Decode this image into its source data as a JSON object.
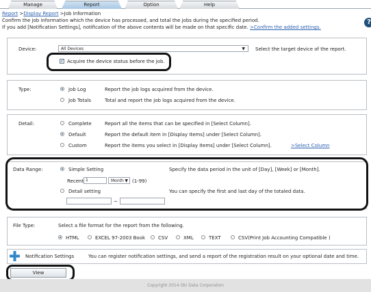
{
  "tabs": [
    {
      "label": "Manage",
      "active": false
    },
    {
      "label": "Report",
      "active": true
    },
    {
      "label": "Option",
      "active": false
    },
    {
      "label": "Help",
      "active": false
    }
  ],
  "breadcrumb": {
    "item1": "Report",
    "item2": "Display Report",
    "current": "Job Information",
    "sep": ">"
  },
  "intro": {
    "line1": "Confirm the job information which the device has processed, and total the jobs during the specified period.",
    "line2": "If you add [Notification Settings], notification of the above contents will be made on that specific date.",
    "link": ">Confirm the added settings."
  },
  "device": {
    "label": "Device:",
    "selected": "All Devices",
    "hint": "Select the target device of the report.",
    "checkbox_label": "Acquire the device status before the job.",
    "checkbox_checked": true
  },
  "type": {
    "label": "Type:",
    "options": [
      {
        "label": "Job Log",
        "desc": "Report the job logs acquired from the device.",
        "checked": true
      },
      {
        "label": "Job Totals",
        "desc": "Total and report the job logs acquired from the device.",
        "checked": false
      }
    ]
  },
  "detail": {
    "label": "Detail:",
    "options": [
      {
        "label": "Complete",
        "desc": "Report all the items that can be specified in [Select Column].",
        "checked": false
      },
      {
        "label": "Default",
        "desc": "Report the default item in [Display Items] under [Select Column].",
        "checked": true
      },
      {
        "label": "Custom",
        "desc": "Report the items you select in [Display Items] under [Select Column].",
        "checked": false
      }
    ],
    "select_column_link": ">Select Column"
  },
  "data_range": {
    "label": "Data Range:",
    "simple_label": "Simple Setting",
    "simple_desc": "Specify the data period in the unit of [Day], [Week] or [Month].",
    "recent_label": "Recent",
    "recent_value": "1",
    "unit_selected": "Month",
    "range_hint": "(1-99)",
    "detail_label": "Detail setting",
    "detail_desc": "You can specify the first and last day of the totaled data.",
    "tilde": "~"
  },
  "file_type": {
    "label": "File Type:",
    "prompt": "Select a file format for the report from the following.",
    "options": [
      {
        "label": "HTML",
        "checked": true
      },
      {
        "label": "EXCEL 97-2003 Book",
        "checked": false
      },
      {
        "label": "CSV",
        "checked": false
      },
      {
        "label": "XML",
        "checked": false
      },
      {
        "label": "TEXT",
        "checked": false
      },
      {
        "label": "CSV(Print Job Accounting Compatible )",
        "checked": false
      }
    ]
  },
  "notification": {
    "label": "Notification Settings",
    "desc": "You can register notification settings, and send a report of the registration result on your optional date and time."
  },
  "view_button": "View",
  "footer": "Copyright 2014 Oki Data Corporation",
  "help_icon": "?",
  "colors": {
    "accent": "#1f4f7d",
    "link": "#2a5fb0",
    "plus": "#2f86c8"
  }
}
